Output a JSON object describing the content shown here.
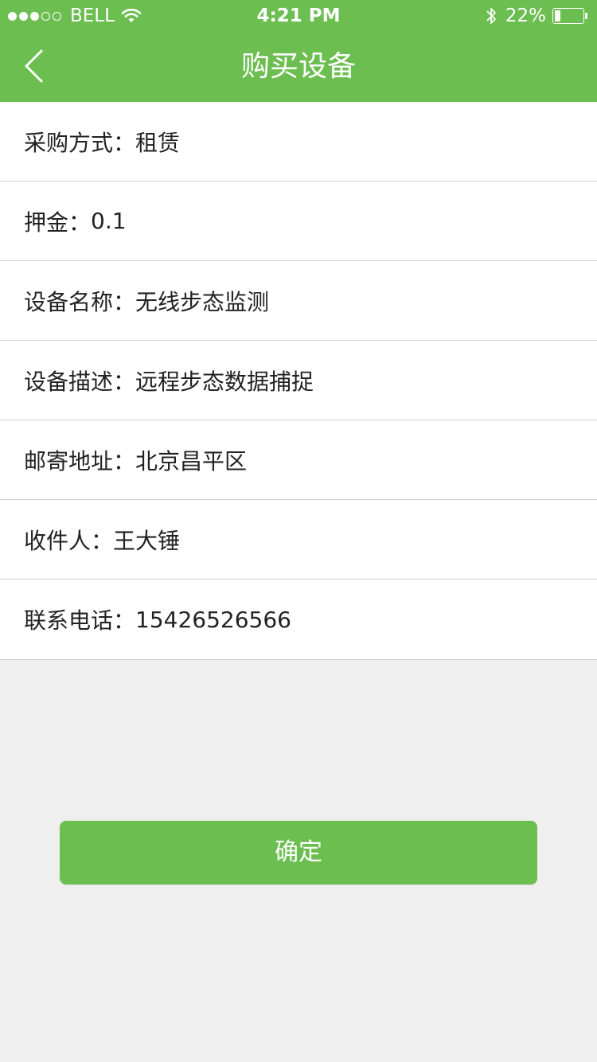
{
  "status_bar": {
    "carrier": "BELL",
    "time": "4:21 PM",
    "battery": "22%",
    "battery_level": 0.22,
    "signal_strength": 3,
    "signal_total": 5
  },
  "nav": {
    "title": "购买设备",
    "back_icon": "chevron-left-icon"
  },
  "rows": [
    {
      "label": "采购方式",
      "sep": "：",
      "value": "租赁"
    },
    {
      "label": "押金",
      "sep": "：",
      "value": "0.1"
    },
    {
      "label": "设备名称",
      "sep": "：",
      "value": "无线步态监测"
    },
    {
      "label": "设备描述",
      "sep": "：",
      "value": "远程步态数据捕捉"
    },
    {
      "label": "邮寄地址",
      "sep": "：",
      "value": "北京昌平区"
    },
    {
      "label": "收件人",
      "sep": "：",
      "value": "王大锤"
    },
    {
      "label": "联系电话",
      "sep": "：",
      "value": "15426526566"
    }
  ],
  "confirm_button": {
    "label": "确定"
  },
  "colors": {
    "accent": "#6cbe51",
    "background": "#efefef"
  }
}
